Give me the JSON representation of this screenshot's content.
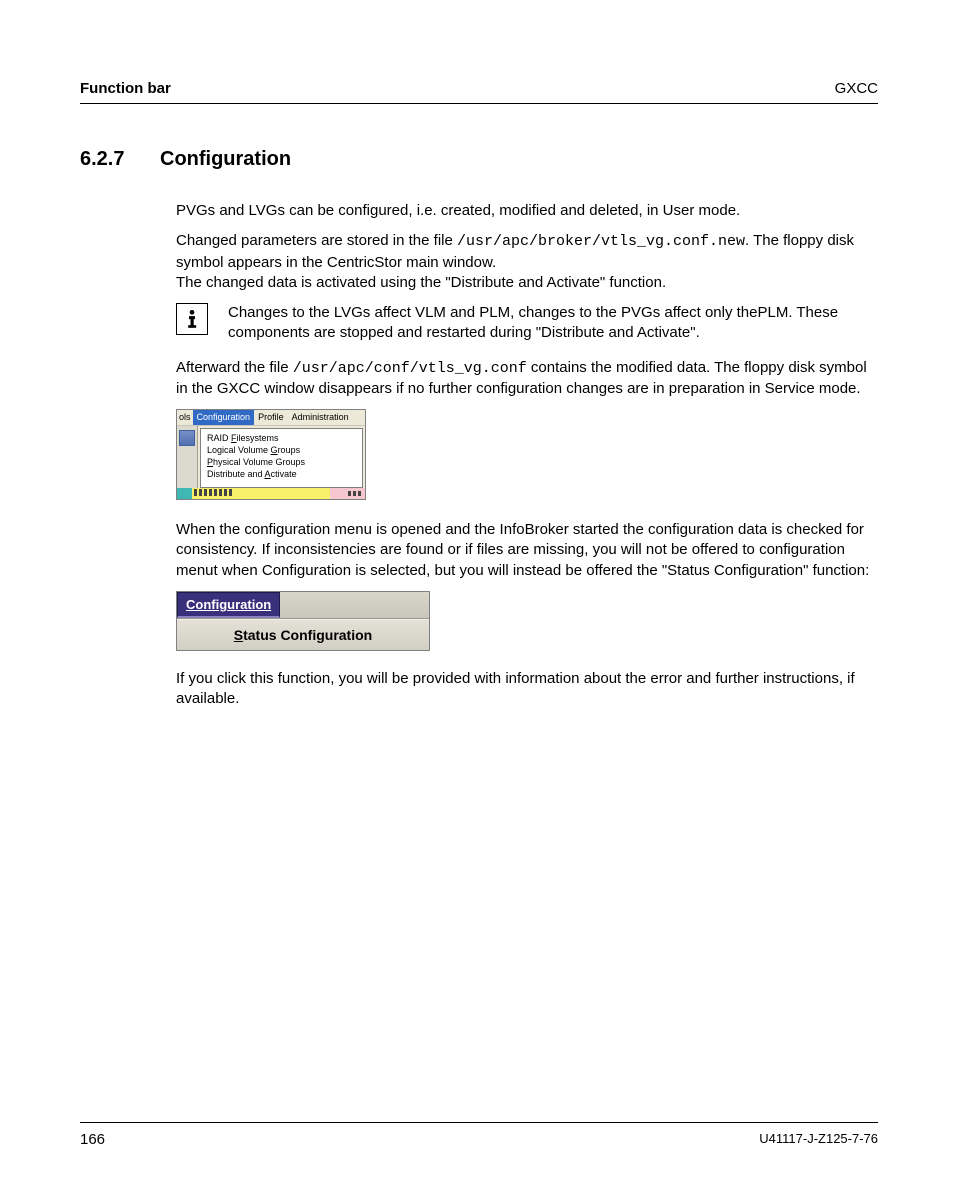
{
  "header": {
    "left": "Function bar",
    "right": "GXCC"
  },
  "section": {
    "number": "6.2.7",
    "title": "Configuration"
  },
  "body": {
    "p1": "PVGs and LVGs can be configured, i.e. created, modified and deleted, in User mode.",
    "p2a": "Changed parameters are stored in the file ",
    "p2code": "/usr/apc/broker/vtls_vg.conf.new",
    "p2b": ". The floppy disk symbol appears in the CentricStor main window.",
    "p3": "The changed data is activated using the \"Distribute and Activate\" function.",
    "info": "Changes to the LVGs affect VLM and PLM, changes to the PVGs affect only thePLM. These components are stopped and restarted during \"Distribute and Activate\".",
    "p4a": "Afterward the file ",
    "p4code": "/usr/apc/conf/vtls_vg.conf",
    "p4b": " contains the modified data. The floppy disk symbol in the GXCC window disappears if no further configuration changes are in preparation in Service mode.",
    "p5": "When the configuration menu is opened and the InfoBroker started the configuration data is checked for consistency. If inconsistencies are found or if files are missing, you will not be offered to configuration menut when Configuration is selected, but you will instead be offered the \"Status Configuration\" function:",
    "p6": "If you click this function, you will be provided with information about the error and further instructions, if available."
  },
  "ui1": {
    "menubar": {
      "truncated": "ols",
      "active": "Configuration",
      "m3": "Profile",
      "m4": "Administration"
    },
    "dropdown": {
      "i1_pre": "RAID ",
      "i1_u": "F",
      "i1_post": "ilesystems",
      "i2_pre": "Logical Volume ",
      "i2_u": "G",
      "i2_post": "roups",
      "i3_u": "P",
      "i3_post": "hysical Volume Groups",
      "i4_pre": "Distribute and ",
      "i4_u": "A",
      "i4_post": "ctivate"
    }
  },
  "ui2": {
    "tab": "Configuration",
    "item_u": "S",
    "item_rest": "tatus Configuration"
  },
  "footer": {
    "page": "166",
    "docid": "U41117-J-Z125-7-76"
  }
}
